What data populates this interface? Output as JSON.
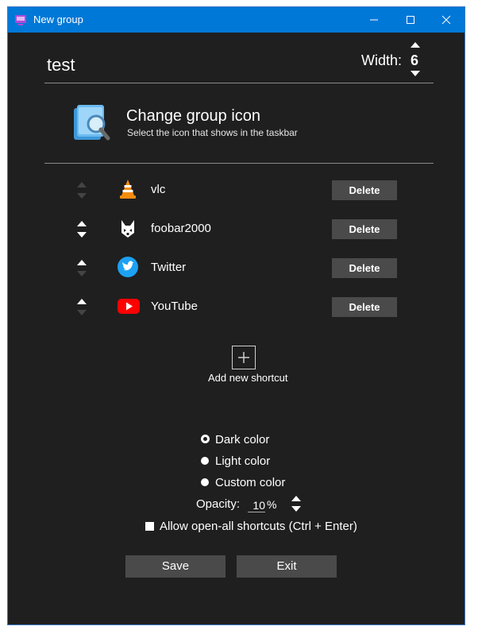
{
  "window": {
    "title": "New group",
    "accent": "#0078d7",
    "background": "#1f1f1f"
  },
  "titlebar": {
    "icon": "group-app-icon",
    "minimize": "minimize-icon",
    "maximize": "maximize-icon",
    "close": "close-icon"
  },
  "header": {
    "group_name": "test",
    "width_label": "Width:",
    "width_value": "6"
  },
  "group_icon": {
    "title": "Change group icon",
    "subtitle": "Select the icon that shows in the taskbar",
    "icon": "folder-magnifier-icon"
  },
  "shortcuts": [
    {
      "name": "vlc",
      "icon": "vlc-icon",
      "delete_label": "Delete"
    },
    {
      "name": "foobar2000",
      "icon": "foobar2000-icon",
      "delete_label": "Delete"
    },
    {
      "name": "Twitter",
      "icon": "twitter-icon",
      "delete_label": "Delete"
    },
    {
      "name": "YouTube",
      "icon": "youtube-icon",
      "delete_label": "Delete"
    }
  ],
  "add_shortcut": {
    "label": "Add new shortcut",
    "icon": "plus-icon"
  },
  "colors": {
    "options": [
      "Dark color",
      "Light color",
      "Custom color"
    ],
    "selected": "Dark color"
  },
  "opacity": {
    "label": "Opacity:",
    "value": "10",
    "unit": "%"
  },
  "open_all": {
    "label": "Allow open-all shortcuts (Ctrl + Enter)",
    "checked": false
  },
  "buttons": {
    "save": "Save",
    "exit": "Exit"
  }
}
